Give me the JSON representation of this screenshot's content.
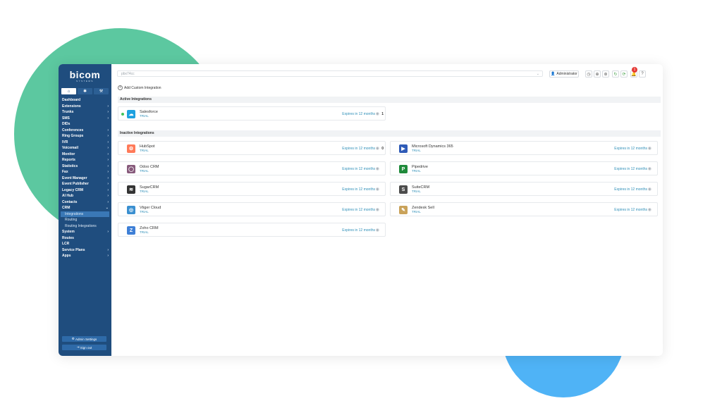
{
  "logo": {
    "name": "bicom",
    "tagline": "SYSTEMS"
  },
  "sidebar": {
    "tabs": [
      {
        "icon": "home-icon",
        "glyph": "⌂"
      },
      {
        "icon": "gear-icon",
        "glyph": "✱"
      },
      {
        "icon": "tools-icon",
        "glyph": "⚒"
      }
    ],
    "items": [
      {
        "label": "Dashboard",
        "arrow": ""
      },
      {
        "label": "Extensions",
        "arrow": "›"
      },
      {
        "label": "Trunks",
        "arrow": "›"
      },
      {
        "label": "SMS",
        "arrow": "›"
      },
      {
        "label": "DIDs",
        "arrow": ""
      },
      {
        "label": "Conferences",
        "arrow": "›"
      },
      {
        "label": "Ring Groups",
        "arrow": "›"
      },
      {
        "label": "IVR",
        "arrow": "›"
      },
      {
        "label": "Voicemail",
        "arrow": "›"
      },
      {
        "label": "Monitor",
        "arrow": "›"
      },
      {
        "label": "Reports",
        "arrow": "›"
      },
      {
        "label": "Statistics",
        "arrow": "›"
      },
      {
        "label": "Fax",
        "arrow": "›"
      },
      {
        "label": "Event Manager",
        "arrow": "›"
      },
      {
        "label": "Event Publisher",
        "arrow": "›"
      },
      {
        "label": "Legacy CRM",
        "arrow": "›"
      },
      {
        "label": "AI Hub",
        "arrow": "›"
      },
      {
        "label": "Contacts",
        "arrow": "›"
      },
      {
        "label": "CRM",
        "arrow": "⌄"
      },
      {
        "label": "Integrations",
        "arrow": "",
        "sub": true,
        "selected": true
      },
      {
        "label": "Routing",
        "arrow": "",
        "sub": true
      },
      {
        "label": "Routing Integrations",
        "arrow": "",
        "sub": true
      },
      {
        "label": "System",
        "arrow": "›"
      },
      {
        "label": "Routes",
        "arrow": ""
      },
      {
        "label": "LCR",
        "arrow": ""
      },
      {
        "label": "Service Plans",
        "arrow": "›"
      },
      {
        "label": "Apps",
        "arrow": "›"
      }
    ],
    "admin_settings": "Admin Settings",
    "sign_out": "Sign out"
  },
  "topbar": {
    "search_value": "pbx74cc",
    "user_label": "Administrator",
    "notification_count": "1"
  },
  "main": {
    "add_custom": "Add Custom Integration",
    "active_title": "Active Integrations",
    "inactive_title": "Inactive Integrations",
    "active": [
      {
        "name": "Salesforce",
        "status": "TRIAL",
        "expires": "Expires in 12 months",
        "count": "1",
        "color": "#1ea1e0"
      }
    ],
    "inactive": [
      {
        "name": "HubSpot",
        "status": "TRIAL",
        "expires": "Expires in 12 months",
        "count": "0",
        "color": "#ff7a59"
      },
      {
        "name": "Microsoft Dynamics 365",
        "status": "TRIAL",
        "expires": "Expires in 12 months",
        "count": "",
        "color": "#2f5bb7"
      },
      {
        "name": "Odoo CRM",
        "status": "TRIAL",
        "expires": "Expires in 12 months",
        "count": "",
        "color": "#875a7b"
      },
      {
        "name": "Pipedrive",
        "status": "TRIAL",
        "expires": "Expires in 12 months",
        "count": "",
        "color": "#1f8a3b"
      },
      {
        "name": "SugarCRM",
        "status": "TRIAL",
        "expires": "Expires in 12 months",
        "count": "",
        "color": "#333333"
      },
      {
        "name": "SuiteCRM",
        "status": "TRIAL",
        "expires": "Expires in 12 months",
        "count": "",
        "color": "#4c4c4c"
      },
      {
        "name": "Vtiger Cloud",
        "status": "TRIAL",
        "expires": "Expires in 12 months",
        "count": "",
        "color": "#3a8fd0"
      },
      {
        "name": "Zendesk Sell",
        "status": "TRIAL",
        "expires": "Expires in 12 months",
        "count": "",
        "color": "#c9a25a"
      },
      {
        "name": "Zoho CRM",
        "status": "TRIAL",
        "expires": "Expires in 12 months",
        "count": "",
        "color": "#3e7fd6"
      }
    ]
  },
  "colors": {
    "sidebar": "#1f4d7e",
    "accent": "#2f8fb8",
    "active_dot": "#43c45c",
    "deco_green": "#5cc8a0",
    "deco_blue": "#4fb3f6"
  }
}
